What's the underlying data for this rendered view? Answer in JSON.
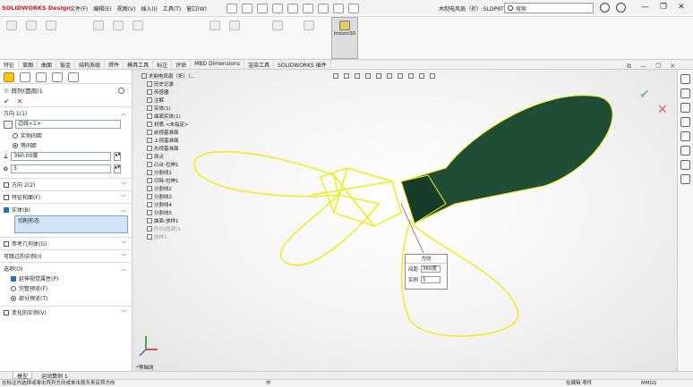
{
  "app": {
    "logo": "SOLIDWORKS Design",
    "document_title": "木制电风扇（折）.SLDPRT"
  },
  "menu": [
    "文件(F)",
    "编辑(E)",
    "视图(V)",
    "插入(I)",
    "工具(T)",
    "窗口(W)"
  ],
  "search": {
    "placeholder": "搜索"
  },
  "ribbon": {
    "instant3d": "Instant3D"
  },
  "cmd_tabs": [
    "特征",
    "草图",
    "曲面",
    "钣金",
    "结构系统",
    "焊件",
    "模具工具",
    "标注",
    "评估",
    "MBD Dimensions",
    "渲染工具",
    "SOLIDWORKS 插件"
  ],
  "pm": {
    "title": "阵列(圆周)1",
    "direction1": {
      "label": "方向 1(1)",
      "axis_value": "边线<1>",
      "options": [
        "实例间距",
        "等间距"
      ],
      "selected": "等间距",
      "angle": "360.00度",
      "count": "3"
    },
    "direction2": {
      "label": "方向 2(2)"
    },
    "features": {
      "label": "特征和面(F)"
    },
    "bodies": {
      "label": "实体(B)",
      "item": "切削形态"
    },
    "sections": [
      "参考几何体(G)",
      "可跳过的实例(I)",
      "选项(O)"
    ],
    "options": {
      "items": [
        "延伸视觉属性(P)",
        "完整预览(F)",
        "部分预览(T)"
      ]
    },
    "variation": "变化的实例(V)"
  },
  "tree": [
    "木制电风扇（折）（...",
    "历史记录",
    "传感器",
    "注解",
    "实体(1)",
    "曲面实体(1)",
    "材质 <未指定>",
    "前视基准面",
    "上视基准面",
    "右视基准面",
    "原点",
    "凸台-拉伸1",
    "分割线1",
    "切除-拉伸1",
    "分割线2",
    "分割线3",
    "分割线4",
    "分割线5",
    "曲面-放样1",
    "阵列(圆周)1",
    "放样1"
  ],
  "popup": {
    "title": "方向",
    "angle_label": "间距",
    "angle_value": "360度",
    "count_label": "实例",
    "count_value": "1"
  },
  "view_label": "*等轴测",
  "bottom_tabs": [
    "模型",
    "运动算例 1"
  ],
  "status": {
    "left": "在标注内选择或单击阵列方向或单击箭头来反转方向",
    "mid": "中",
    "right1": "在编辑 零件",
    "right2": "MMGS"
  },
  "colors": {
    "accent": "#2a6fbf",
    "model": "#1f4d36",
    "preview": "#f0ec1d"
  }
}
